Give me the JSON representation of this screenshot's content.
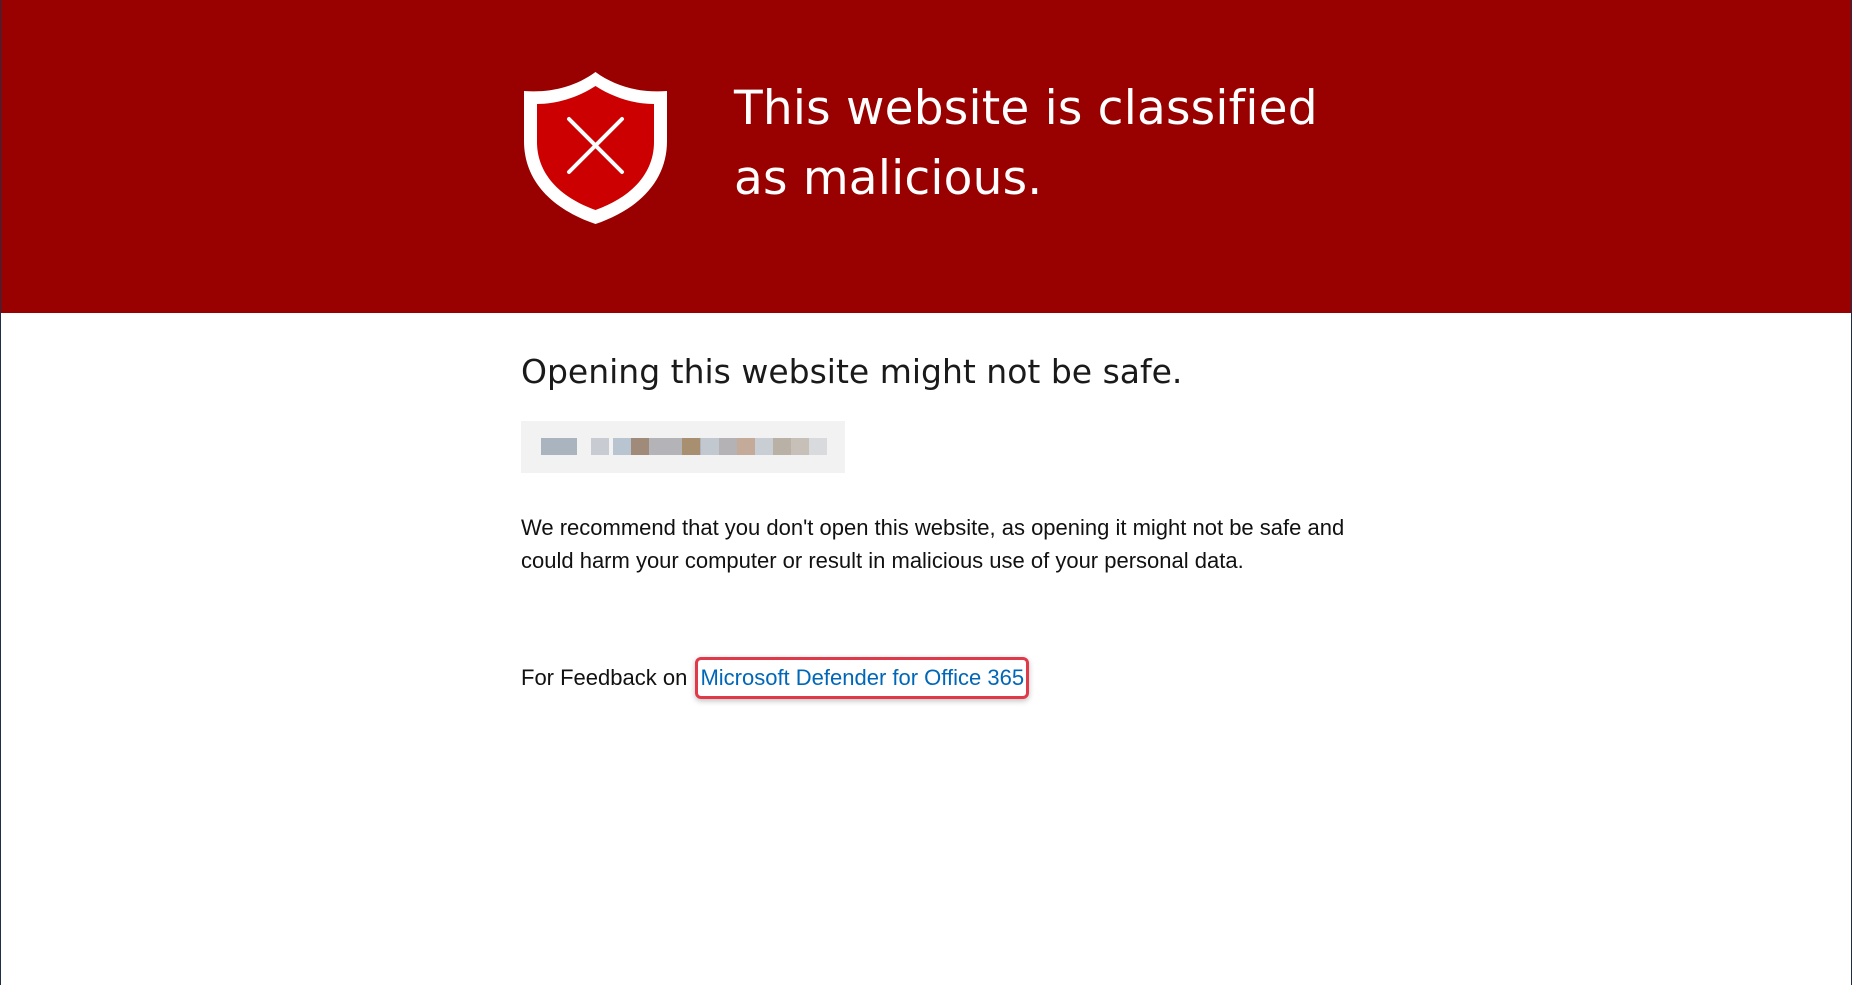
{
  "banner": {
    "title": "This website is classified as malicious.",
    "icon": "shield-x-icon",
    "background_color": "#990000",
    "shield_color": "#cc0000"
  },
  "content": {
    "subheading": "Opening this website might not be safe.",
    "url": "",
    "description": "We recommend that you don't open this website, as opening it might not be safe and could harm your computer or result in malicious use of your personal data.",
    "feedback_prefix": "For Feedback on",
    "feedback_link": "Microsoft Defender for Office 365",
    "link_color": "#0067b8"
  }
}
